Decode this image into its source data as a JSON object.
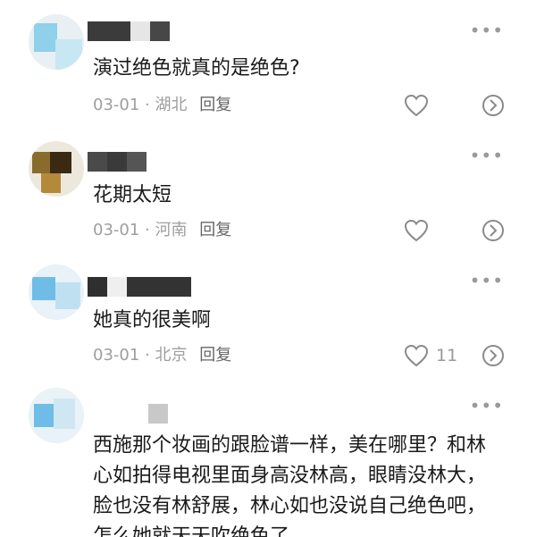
{
  "comments": [
    {
      "text": "演过绝色就真的是绝色?",
      "date": "03-01",
      "location": "湖北",
      "reply_label": "回复",
      "likes": ""
    },
    {
      "text": "花期太短",
      "date": "03-01",
      "location": "河南",
      "reply_label": "回复",
      "likes": ""
    },
    {
      "text": "她真的很美啊",
      "date": "03-01",
      "location": "北京",
      "reply_label": "回复",
      "likes": "11"
    },
    {
      "text": "西施那个妆画的跟脸谱一样，美在哪里？和林心如拍得电视里面身高没林高，眼睛没林大，脸也没有林舒展，林心如也没说自己绝色吧，怎么她就天天吹绝色了"
    }
  ],
  "icons": {
    "more": "more-dots-icon",
    "like": "heart-outline-icon",
    "share": "share-reply-icon"
  },
  "colors": {
    "text": "#1a1a1a",
    "meta": "#9e9e9e",
    "icon": "#8a8a8a"
  }
}
